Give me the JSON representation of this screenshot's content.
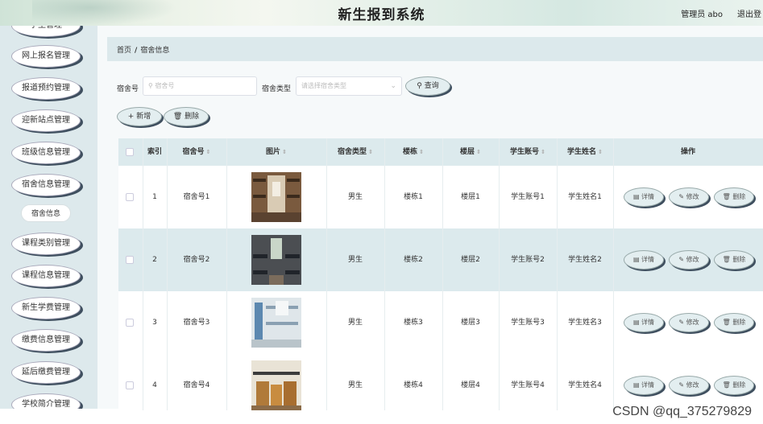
{
  "header": {
    "title": "新生报到系统",
    "user": "管理员 abo",
    "logout": "退出登"
  },
  "sidebar": {
    "items": [
      {
        "label": "学生管理"
      },
      {
        "label": "网上报名管理"
      },
      {
        "label": "报道预约管理"
      },
      {
        "label": "迎新站点管理"
      },
      {
        "label": "班级信息管理"
      },
      {
        "label": "宿舍信息管理"
      },
      {
        "label": "课程类别管理"
      },
      {
        "label": "课程信息管理"
      },
      {
        "label": "新生学费管理"
      },
      {
        "label": "缴费信息管理"
      },
      {
        "label": "延后缴费管理"
      },
      {
        "label": "学校简介管理"
      }
    ],
    "submenu": "宿舍信息"
  },
  "breadcrumb": {
    "home": "首页",
    "sep": "/",
    "current": "宿舍信息"
  },
  "search": {
    "label1": "宿舍号",
    "placeholder1": "宿舍号",
    "label2": "宿舍类型",
    "placeholder2": "请选择宿舍类型",
    "query": "查询"
  },
  "actions": {
    "add": "新增",
    "delete": "删除"
  },
  "table": {
    "headers": [
      "索引",
      "宿舍号",
      "图片",
      "宿舍类型",
      "楼栋",
      "楼层",
      "学生账号",
      "学生姓名",
      "操作"
    ],
    "row_buttons": {
      "detail": "详情",
      "edit": "修改",
      "delete": "删除"
    },
    "rows": [
      {
        "index": "1",
        "room": "宿舍号1",
        "type": "男生",
        "building": "楼栋1",
        "floor": "楼层1",
        "account": "学生账号1",
        "name": "学生姓名1"
      },
      {
        "index": "2",
        "room": "宿舍号2",
        "type": "男生",
        "building": "楼栋2",
        "floor": "楼层2",
        "account": "学生账号2",
        "name": "学生姓名2"
      },
      {
        "index": "3",
        "room": "宿舍号3",
        "type": "男生",
        "building": "楼栋3",
        "floor": "楼层3",
        "account": "学生账号3",
        "name": "学生姓名3"
      },
      {
        "index": "4",
        "room": "宿舍号4",
        "type": "男生",
        "building": "楼栋4",
        "floor": "楼层4",
        "account": "学生账号4",
        "name": "学生姓名4"
      }
    ]
  },
  "watermark": "CSDN @qq_375279829",
  "colors": {
    "sidebar_bg": "#dde9ec",
    "table_header": "#dceaed",
    "button_shadow": "#3f4f5f"
  }
}
